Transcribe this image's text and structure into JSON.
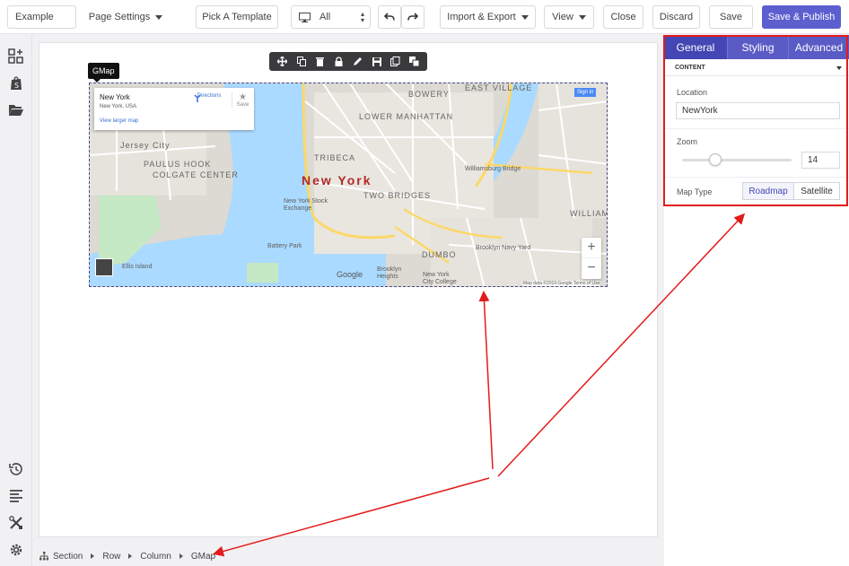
{
  "topbar": {
    "page_name": "Example",
    "page_settings": "Page Settings",
    "pick_template": "Pick A Template",
    "device_select": "All",
    "import_export": "Import & Export",
    "view": "View",
    "close": "Close",
    "discard": "Discard",
    "save": "Save",
    "save_publish": "Save & Publish"
  },
  "element_tag": "GMap",
  "map": {
    "place_name": "New York",
    "place_address": "New York, USA",
    "view_larger": "View larger map",
    "directions": "Directions",
    "save": "Save",
    "sign_in": "Sign in",
    "city_label": "New York",
    "labels": {
      "jersey_city": "Jersey City",
      "paulus_hook": "PAULUS HOOK",
      "colgate_center": "COLGATE CENTER",
      "tribeca": "TRIBECA",
      "lower_manhattan": "LOWER MANHATTAN",
      "bowery": "BOWERY",
      "east_village": "EAST VILLAGE",
      "two_bridges": "TWO BRIDGES",
      "dumbo": "DUMBO",
      "williamsburg": "WILLIAMSBURG",
      "brooklyn_navy_yard": "Brooklyn Navy Yard",
      "williamsburg_bridge": "Williamsburg Bridge",
      "new_york_city_college": "New York City College",
      "ellis_island": "Ellis Island",
      "battery_park": "Battery Park",
      "brooklyn_heights": "Brooklyn Heights",
      "nyc_stock_exchange": "New York Stock Exchange",
      "google": "Google",
      "attribution": "Map data ©2019 Google  Terms of Use"
    }
  },
  "panel": {
    "tabs": [
      "General",
      "Styling",
      "Advanced"
    ],
    "section_title": "CONTENT",
    "location_label": "Location",
    "location_value": "NewYork",
    "zoom_label": "Zoom",
    "zoom_value": "14",
    "zoom_fraction": 0.3,
    "map_type_label": "Map Type",
    "map_type_options": [
      "Roadmap",
      "Satellite"
    ],
    "map_type_selected": "Roadmap"
  },
  "breadcrumb": [
    "Section",
    "Row",
    "Column",
    "GMap"
  ],
  "colors": {
    "accent": "#5a5bc4",
    "annotation": "#e31b1b"
  }
}
